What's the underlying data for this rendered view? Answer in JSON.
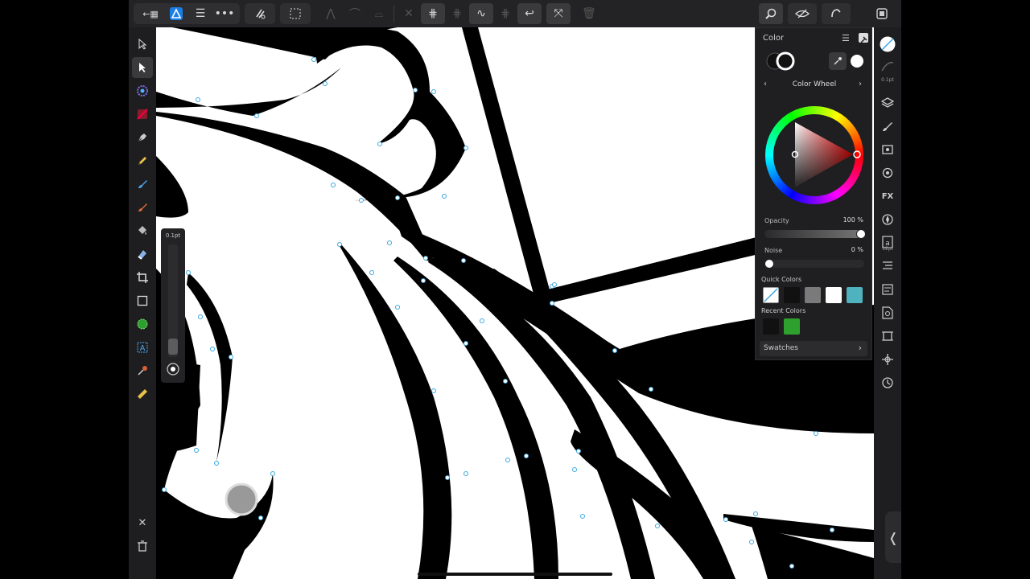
{
  "app": {
    "name": "Affinity Designer"
  },
  "brush": {
    "size_label": "0.1pt"
  },
  "color_panel": {
    "title": "Color",
    "mode": "Color Wheel",
    "opacity_label": "Opacity",
    "opacity_value": "100 %",
    "opacity": 1.0,
    "noise_label": "Noise",
    "noise_value": "0 %",
    "noise": 0.0,
    "quick_colors_label": "Quick Colors",
    "quick_colors": [
      "none",
      "#111111",
      "#7a7a7a",
      "#ffffff",
      "#4fb3bf"
    ],
    "recent_colors_label": "Recent Colors",
    "recent_colors": [
      "#111111",
      "#2ea02e"
    ],
    "swatches_label": "Swatches"
  },
  "right_toolbar": {
    "stroke_width_label": "0.1pt",
    "text_size_label": "12pt"
  },
  "colors": {
    "ui_dark": "#1c1c1e",
    "canvas": "#ffffff",
    "selection": "#3aa7e0"
  },
  "icons": {
    "back": "back-grid-icon",
    "logo": "affinity-logo-icon",
    "document_menu": "hamburger-icon",
    "more": "more-dots-icon",
    "snapping": "magnet-icon",
    "selection": "marquee-icon",
    "undo": "undo-icon",
    "delete": "trash-icon"
  }
}
